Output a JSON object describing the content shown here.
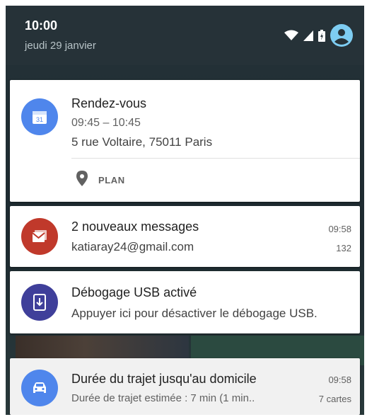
{
  "status_bar": {
    "time": "10:00",
    "date": "jeudi 29 janvier",
    "icons": [
      "wifi-icon",
      "signal-icon",
      "battery-icon",
      "account-icon"
    ]
  },
  "notifications": [
    {
      "app_icon": "calendar-icon",
      "icon_color": "#4f86ec",
      "icon_text": "31",
      "title": "Rendez-vous",
      "line1": "09:45 – 10:45",
      "line2": "5 rue Voltaire, 75011 Paris",
      "action": {
        "icon": "location-pin-icon",
        "label": "PLAN"
      }
    },
    {
      "app_icon": "mail-icon",
      "icon_color": "#c0392b",
      "title": "2 nouveaux messages",
      "line1": "katiaray24@gmail.com",
      "time": "09:58",
      "count": "132"
    },
    {
      "app_icon": "usb-debug-icon",
      "icon_color": "#3f3f9a",
      "title": "Débogage USB activé",
      "line1": "Appuyer ici pour désactiver le débogage USB."
    },
    {
      "app_icon": "car-icon",
      "icon_color": "#4f86ec",
      "title": "Durée du trajet jusqu'au domicile",
      "line1": "Durée de trajet estimée : 7 min (1 min..",
      "time": "09:58",
      "count": "7 cartes"
    }
  ]
}
